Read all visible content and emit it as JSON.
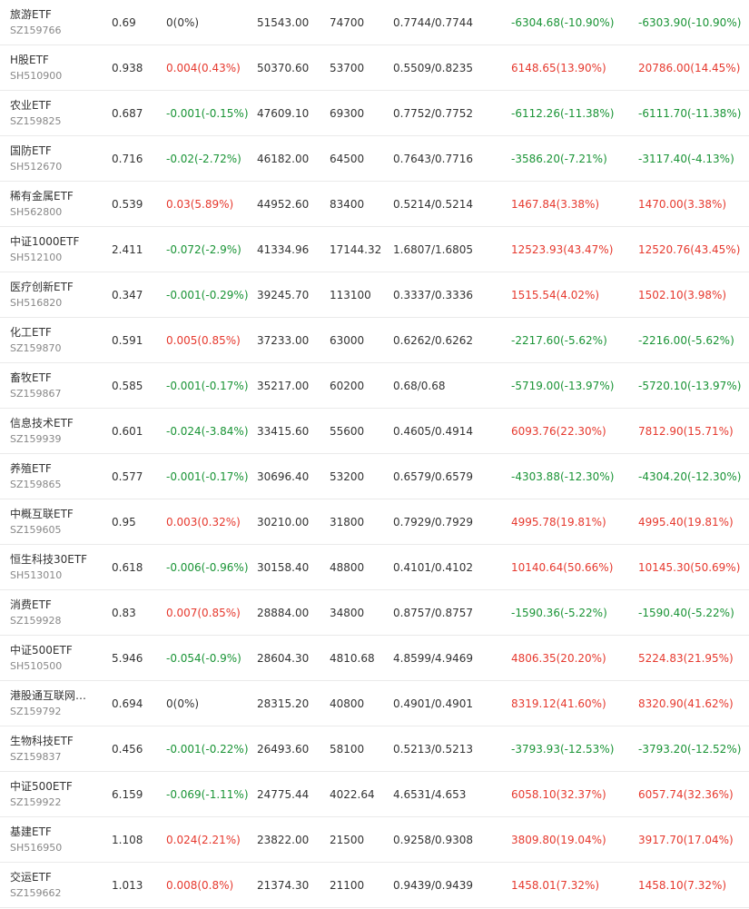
{
  "colors": {
    "up": "#e6392e",
    "down": "#1a9436",
    "flat": "#333333"
  },
  "rows": [
    {
      "name": "旅游ETF",
      "code": "SZ159766",
      "price": "0.69",
      "change": "0(0%)",
      "change_dir": "flat",
      "amount": "51543.00",
      "shares": "74700",
      "nav": "0.7744/0.7744",
      "flow1": "-6304.68(-10.90%)",
      "flow1_dir": "down",
      "flow2": "-6303.90(-10.90%)",
      "flow2_dir": "down"
    },
    {
      "name": "H股ETF",
      "code": "SH510900",
      "price": "0.938",
      "change": "0.004(0.43%)",
      "change_dir": "up",
      "amount": "50370.60",
      "shares": "53700",
      "nav": "0.5509/0.8235",
      "flow1": "6148.65(13.90%)",
      "flow1_dir": "up",
      "flow2": "20786.00(14.45%)",
      "flow2_dir": "up"
    },
    {
      "name": "农业ETF",
      "code": "SZ159825",
      "price": "0.687",
      "change": "-0.001(-0.15%)",
      "change_dir": "down",
      "amount": "47609.10",
      "shares": "69300",
      "nav": "0.7752/0.7752",
      "flow1": "-6112.26(-11.38%)",
      "flow1_dir": "down",
      "flow2": "-6111.70(-11.38%)",
      "flow2_dir": "down"
    },
    {
      "name": "国防ETF",
      "code": "SH512670",
      "price": "0.716",
      "change": "-0.02(-2.72%)",
      "change_dir": "down",
      "amount": "46182.00",
      "shares": "64500",
      "nav": "0.7643/0.7716",
      "flow1": "-3586.20(-7.21%)",
      "flow1_dir": "down",
      "flow2": "-3117.40(-4.13%)",
      "flow2_dir": "down"
    },
    {
      "name": "稀有金属ETF",
      "code": "SH562800",
      "price": "0.539",
      "change": "0.03(5.89%)",
      "change_dir": "up",
      "amount": "44952.60",
      "shares": "83400",
      "nav": "0.5214/0.5214",
      "flow1": "1467.84(3.38%)",
      "flow1_dir": "up",
      "flow2": "1470.00(3.38%)",
      "flow2_dir": "up"
    },
    {
      "name": "中证1000ETF",
      "code": "SH512100",
      "price": "2.411",
      "change": "-0.072(-2.9%)",
      "change_dir": "down",
      "amount": "41334.96",
      "shares": "17144.32",
      "nav": "1.6807/1.6805",
      "flow1": "12523.93(43.47%)",
      "flow1_dir": "up",
      "flow2": "12520.76(43.45%)",
      "flow2_dir": "up"
    },
    {
      "name": "医疗创新ETF",
      "code": "SH516820",
      "price": "0.347",
      "change": "-0.001(-0.29%)",
      "change_dir": "down",
      "amount": "39245.70",
      "shares": "113100",
      "nav": "0.3337/0.3336",
      "flow1": "1515.54(4.02%)",
      "flow1_dir": "up",
      "flow2": "1502.10(3.98%)",
      "flow2_dir": "up"
    },
    {
      "name": "化工ETF",
      "code": "SZ159870",
      "price": "0.591",
      "change": "0.005(0.85%)",
      "change_dir": "up",
      "amount": "37233.00",
      "shares": "63000",
      "nav": "0.6262/0.6262",
      "flow1": "-2217.60(-5.62%)",
      "flow1_dir": "down",
      "flow2": "-2216.00(-5.62%)",
      "flow2_dir": "down"
    },
    {
      "name": "畜牧ETF",
      "code": "SZ159867",
      "price": "0.585",
      "change": "-0.001(-0.17%)",
      "change_dir": "down",
      "amount": "35217.00",
      "shares": "60200",
      "nav": "0.68/0.68",
      "flow1": "-5719.00(-13.97%)",
      "flow1_dir": "down",
      "flow2": "-5720.10(-13.97%)",
      "flow2_dir": "down"
    },
    {
      "name": "信息技术ETF",
      "code": "SZ159939",
      "price": "0.601",
      "change": "-0.024(-3.84%)",
      "change_dir": "down",
      "amount": "33415.60",
      "shares": "55600",
      "nav": "0.4605/0.4914",
      "flow1": "6093.76(22.30%)",
      "flow1_dir": "up",
      "flow2": "7812.90(15.71%)",
      "flow2_dir": "up"
    },
    {
      "name": "养殖ETF",
      "code": "SZ159865",
      "price": "0.577",
      "change": "-0.001(-0.17%)",
      "change_dir": "down",
      "amount": "30696.40",
      "shares": "53200",
      "nav": "0.6579/0.6579",
      "flow1": "-4303.88(-12.30%)",
      "flow1_dir": "down",
      "flow2": "-4304.20(-12.30%)",
      "flow2_dir": "down"
    },
    {
      "name": "中概互联ETF",
      "code": "SZ159605",
      "price": "0.95",
      "change": "0.003(0.32%)",
      "change_dir": "up",
      "amount": "30210.00",
      "shares": "31800",
      "nav": "0.7929/0.7929",
      "flow1": "4995.78(19.81%)",
      "flow1_dir": "up",
      "flow2": "4995.40(19.81%)",
      "flow2_dir": "up"
    },
    {
      "name": "恒生科技30ETF",
      "code": "SH513010",
      "price": "0.618",
      "change": "-0.006(-0.96%)",
      "change_dir": "down",
      "amount": "30158.40",
      "shares": "48800",
      "nav": "0.4101/0.4102",
      "flow1": "10140.64(50.66%)",
      "flow1_dir": "up",
      "flow2": "10145.30(50.69%)",
      "flow2_dir": "up"
    },
    {
      "name": "消费ETF",
      "code": "SZ159928",
      "price": "0.83",
      "change": "0.007(0.85%)",
      "change_dir": "up",
      "amount": "28884.00",
      "shares": "34800",
      "nav": "0.8757/0.8757",
      "flow1": "-1590.36(-5.22%)",
      "flow1_dir": "down",
      "flow2": "-1590.40(-5.22%)",
      "flow2_dir": "down"
    },
    {
      "name": "中证500ETF",
      "code": "SH510500",
      "price": "5.946",
      "change": "-0.054(-0.9%)",
      "change_dir": "down",
      "amount": "28604.30",
      "shares": "4810.68",
      "nav": "4.8599/4.9469",
      "flow1": "4806.35(20.20%)",
      "flow1_dir": "up",
      "flow2": "5224.83(21.95%)",
      "flow2_dir": "up"
    },
    {
      "name": "港股通互联网…",
      "code": "SZ159792",
      "price": "0.694",
      "change": "0(0%)",
      "change_dir": "flat",
      "amount": "28315.20",
      "shares": "40800",
      "nav": "0.4901/0.4901",
      "flow1": "8319.12(41.60%)",
      "flow1_dir": "up",
      "flow2": "8320.90(41.62%)",
      "flow2_dir": "up"
    },
    {
      "name": "生物科技ETF",
      "code": "SZ159837",
      "price": "0.456",
      "change": "-0.001(-0.22%)",
      "change_dir": "down",
      "amount": "26493.60",
      "shares": "58100",
      "nav": "0.5213/0.5213",
      "flow1": "-3793.93(-12.53%)",
      "flow1_dir": "down",
      "flow2": "-3793.20(-12.52%)",
      "flow2_dir": "down"
    },
    {
      "name": "中证500ETF",
      "code": "SZ159922",
      "price": "6.159",
      "change": "-0.069(-1.11%)",
      "change_dir": "down",
      "amount": "24775.44",
      "shares": "4022.64",
      "nav": "4.6531/4.653",
      "flow1": "6058.10(32.37%)",
      "flow1_dir": "up",
      "flow2": "6057.74(32.36%)",
      "flow2_dir": "up"
    },
    {
      "name": "基建ETF",
      "code": "SH516950",
      "price": "1.108",
      "change": "0.024(2.21%)",
      "change_dir": "up",
      "amount": "23822.00",
      "shares": "21500",
      "nav": "0.9258/0.9308",
      "flow1": "3809.80(19.04%)",
      "flow1_dir": "up",
      "flow2": "3917.70(17.04%)",
      "flow2_dir": "up"
    },
    {
      "name": "交运ETF",
      "code": "SZ159662",
      "price": "1.013",
      "change": "0.008(0.8%)",
      "change_dir": "up",
      "amount": "21374.30",
      "shares": "21100",
      "nav": "0.9439/0.9439",
      "flow1": "1458.01(7.32%)",
      "flow1_dir": "up",
      "flow2": "1458.10(7.32%)",
      "flow2_dir": "up"
    }
  ]
}
